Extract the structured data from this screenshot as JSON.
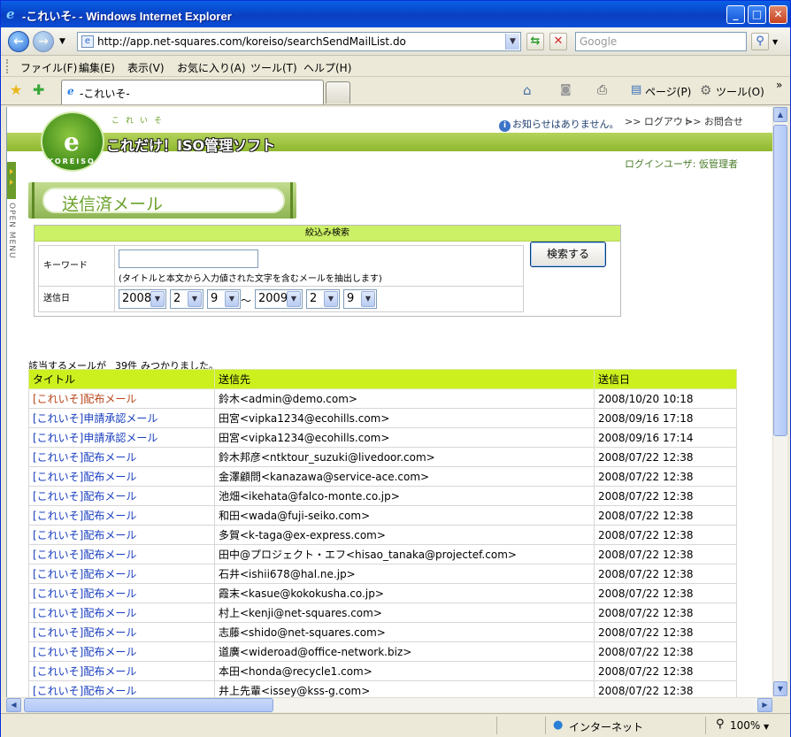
{
  "window": {
    "title": "-これいそ- - Windows Internet Explorer",
    "minimize": "_",
    "maximize": "□",
    "close": "✕"
  },
  "address": {
    "url": "http://app.net-squares.com/koreiso/searchSendMailList.do",
    "search_placeholder": "Google"
  },
  "menu": [
    "ファイル(F)",
    "編集(E)",
    "表示(V)",
    "お気に入り(A)",
    "ツール(T)",
    "ヘルプ(H)"
  ],
  "tab": {
    "label": "-これいそ-"
  },
  "commands": {
    "page": "ページ(P)",
    "tools": "ツール(O)"
  },
  "status": {
    "zone": "インターネット",
    "zoom": "100%"
  },
  "header": {
    "kana": "これいそ",
    "brand": "これだけ！ISO管理ソフト",
    "logo_letter": "e",
    "logo_text": "KOREISO",
    "notice": "お知らせはありません。",
    "logout": ">> ログアウト",
    "contact": ">> お問合せ",
    "login_user": "ログインユーザ: 仮管理者",
    "open_menu": "OPEN MENU"
  },
  "page": {
    "heading": "送信済メール"
  },
  "search": {
    "title": "絞込み検索",
    "keyword_label": "キーワード",
    "keyword_value": "",
    "keyword_hint": "(タイトルと本文から入力値された文字を含むメールを抽出します)",
    "date_label": "送信日",
    "from": {
      "year": "2008",
      "month": "2",
      "day": "9"
    },
    "tilde": "～",
    "to": {
      "year": "2009",
      "month": "2",
      "day": "9"
    },
    "button": "検索する"
  },
  "results": {
    "prefix": "該当するメールが",
    "count": "39件",
    "suffix": "みつかりました。",
    "columns": [
      "タイトル",
      "送信先",
      "送信日"
    ],
    "rows": [
      {
        "title": "[これいそ]配布メール",
        "to": "鈴木<admin@demo.com>",
        "date": "2008/10/20 10:18",
        "visited": true
      },
      {
        "title": "[これいそ]申請承認メール",
        "to": "田宮<vipka1234@ecohills.com>",
        "date": "2008/09/16 17:18",
        "visited": false
      },
      {
        "title": "[これいそ]申請承認メール",
        "to": "田宮<vipka1234@ecohills.com>",
        "date": "2008/09/16 17:14",
        "visited": false
      },
      {
        "title": "[これいそ]配布メール",
        "to": "鈴木邦彦<ntktour_suzuki@livedoor.com>",
        "date": "2008/07/22 12:38",
        "visited": false
      },
      {
        "title": "[これいそ]配布メール",
        "to": "金澤顧問<kanazawa@service-ace.com>",
        "date": "2008/07/22 12:38",
        "visited": false
      },
      {
        "title": "[これいそ]配布メール",
        "to": "池畑<ikehata@falco-monte.co.jp>",
        "date": "2008/07/22 12:38",
        "visited": false
      },
      {
        "title": "[これいそ]配布メール",
        "to": "和田<wada@fuji-seiko.com>",
        "date": "2008/07/22 12:38",
        "visited": false
      },
      {
        "title": "[これいそ]配布メール",
        "to": "多賀<k-taga@ex-express.com>",
        "date": "2008/07/22 12:38",
        "visited": false
      },
      {
        "title": "[これいそ]配布メール",
        "to": "田中@プロジェクト・エフ<hisao_tanaka@projectef.com>",
        "date": "2008/07/22 12:38",
        "visited": false
      },
      {
        "title": "[これいそ]配布メール",
        "to": "石井<ishii678@hal.ne.jp>",
        "date": "2008/07/22 12:38",
        "visited": false
      },
      {
        "title": "[これいそ]配布メール",
        "to": "霞末<kasue@kokokusha.co.jp>",
        "date": "2008/07/22 12:38",
        "visited": false
      },
      {
        "title": "[これいそ]配布メール",
        "to": "村上<kenji@net-squares.com>",
        "date": "2008/07/22 12:38",
        "visited": false
      },
      {
        "title": "[これいそ]配布メール",
        "to": "志藤<shido@net-squares.com>",
        "date": "2008/07/22 12:38",
        "visited": false
      },
      {
        "title": "[これいそ]配布メール",
        "to": "道廣<wideroad@office-network.biz>",
        "date": "2008/07/22 12:38",
        "visited": false
      },
      {
        "title": "[これいそ]配布メール",
        "to": "本田<honda@recycle1.com>",
        "date": "2008/07/22 12:38",
        "visited": false
      },
      {
        "title": "[これいそ]配布メール",
        "to": "井上先輩<issey@kss-g.com>",
        "date": "2008/07/22 12:38",
        "visited": false
      }
    ]
  }
}
